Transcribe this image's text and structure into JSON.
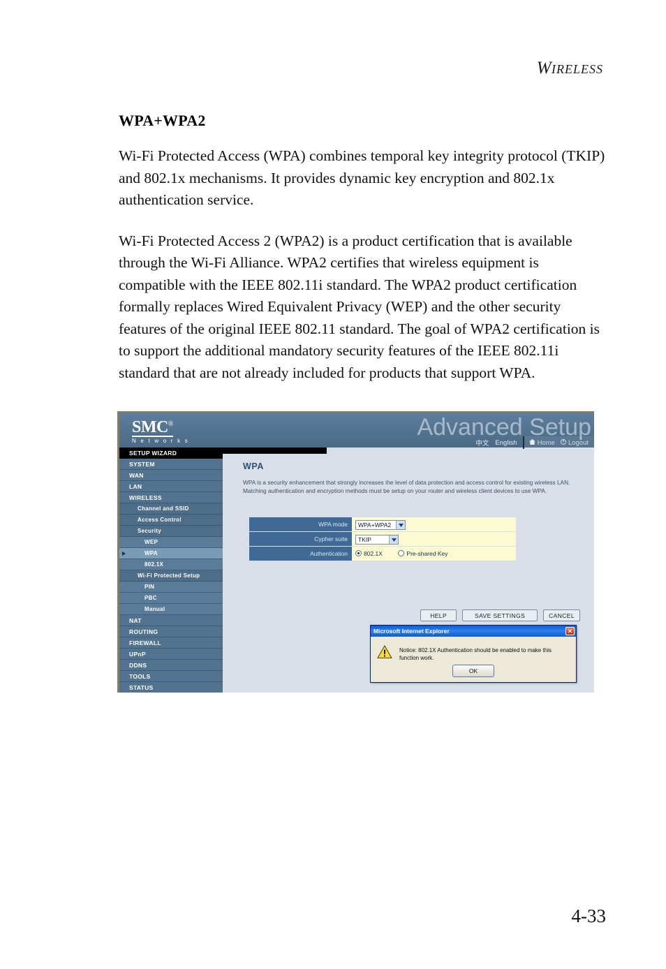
{
  "document": {
    "running_header": {
      "cap": "W",
      "rest": "IRELESS"
    },
    "section_title": "WPA+WPA2",
    "paragraphs": [
      "Wi-Fi Protected Access (WPA) combines temporal key integrity protocol (TKIP) and 802.1x mechanisms. It provides dynamic key encryption and 802.1x authentication service.",
      "Wi-Fi Protected Access 2 (WPA2) is a product certification that is available through the Wi-Fi Alliance. WPA2 certifies that wireless equipment is compatible with the IEEE 802.11i standard. The WPA2 product certification formally replaces Wired Equivalent Privacy (WEP) and the other security features of the original IEEE 802.11 standard. The goal of WPA2 certification is to support the additional mandatory security features of the IEEE 802.11i standard that are not already included for products that support WPA."
    ],
    "page_number": "4-33"
  },
  "screenshot": {
    "brand": {
      "mark": "SMC",
      "registered": "®",
      "tagline": "N e t w o r k s"
    },
    "watermark": "Advanced Setup",
    "nav": {
      "languages": [
        "中文",
        "English"
      ],
      "home_label": "Home",
      "logout_label": "Logout",
      "home_icon": "home-icon",
      "logout_icon": "logout-icon"
    },
    "sidebar": {
      "items": [
        {
          "label": "SETUP WIZARD",
          "level": 0,
          "style": "wizard",
          "selected": false
        },
        {
          "label": "SYSTEM",
          "level": 0,
          "style": "lvl0",
          "selected": false
        },
        {
          "label": "WAN",
          "level": 0,
          "style": "lvl0",
          "selected": false
        },
        {
          "label": "LAN",
          "level": 0,
          "style": "lvl0",
          "selected": false
        },
        {
          "label": "WIRELESS",
          "level": 0,
          "style": "lvl0",
          "selected": false
        },
        {
          "label": "Channel and SSID",
          "level": 1,
          "style": "lvl1",
          "selected": false
        },
        {
          "label": "Access Control",
          "level": 1,
          "style": "lvl1",
          "selected": false
        },
        {
          "label": "Security",
          "level": 1,
          "style": "lvl1",
          "selected": false
        },
        {
          "label": "WEP",
          "level": 2,
          "style": "lvl2",
          "selected": false
        },
        {
          "label": "WPA",
          "level": 2,
          "style": "lvl2",
          "selected": true
        },
        {
          "label": "802.1X",
          "level": 2,
          "style": "lvl2",
          "selected": false
        },
        {
          "label": "Wi-Fi Protected Setup",
          "level": 1,
          "style": "lvl1",
          "selected": false
        },
        {
          "label": "PIN",
          "level": 2,
          "style": "lvl2",
          "selected": false
        },
        {
          "label": "PBC",
          "level": 2,
          "style": "lvl2",
          "selected": false
        },
        {
          "label": "Manual",
          "level": 2,
          "style": "lvl2",
          "selected": false
        },
        {
          "label": "NAT",
          "level": 0,
          "style": "lvl0",
          "selected": false
        },
        {
          "label": "ROUTING",
          "level": 0,
          "style": "lvl0",
          "selected": false
        },
        {
          "label": "FIREWALL",
          "level": 0,
          "style": "lvl0",
          "selected": false
        },
        {
          "label": "UPnP",
          "level": 0,
          "style": "lvl0",
          "selected": false
        },
        {
          "label": "DDNS",
          "level": 0,
          "style": "lvl0",
          "selected": false
        },
        {
          "label": "TOOLS",
          "level": 0,
          "style": "lvl0",
          "selected": false
        },
        {
          "label": "STATUS",
          "level": 0,
          "style": "lvl0",
          "selected": false
        }
      ]
    },
    "content": {
      "title": "WPA",
      "description": "WPA is a security enhancement that strongly increases the level of data protection and access control for existing wireless LAN. Matching authentication and encryption methods must be setup on your router and wireless client devices to use WPA.",
      "fields": {
        "wpa_mode_label": "WPA mode",
        "wpa_mode_value": "WPA+WPA2",
        "cypher_suite_label": "Cypher suite",
        "cypher_suite_value": "TKIP",
        "authentication_label": "Authentication",
        "auth_option_1": "802.1X",
        "auth_option_2": "Pre-shared Key",
        "auth_selected": "802.1X"
      },
      "buttons": {
        "help": "HELP",
        "save": "SAVE SETTINGS",
        "cancel": "CANCEL"
      }
    },
    "dialog": {
      "title": "Microsoft Internet Explorer",
      "close_icon": "close-icon",
      "warning_icon": "warning-triangle-icon",
      "message": "Notice: 802.1X Authentication should be enabled to make this function work.",
      "ok_label": "OK"
    },
    "colors": {
      "brand_blue": "#52738f",
      "label_blue": "#3f6a96",
      "field_yellow": "#fbfad0",
      "panel_gray": "#d8dfe8",
      "title_blue": "#2d4f72",
      "dialog_title": "#0a5ad4",
      "selected_row": "#7b9ab5"
    }
  }
}
